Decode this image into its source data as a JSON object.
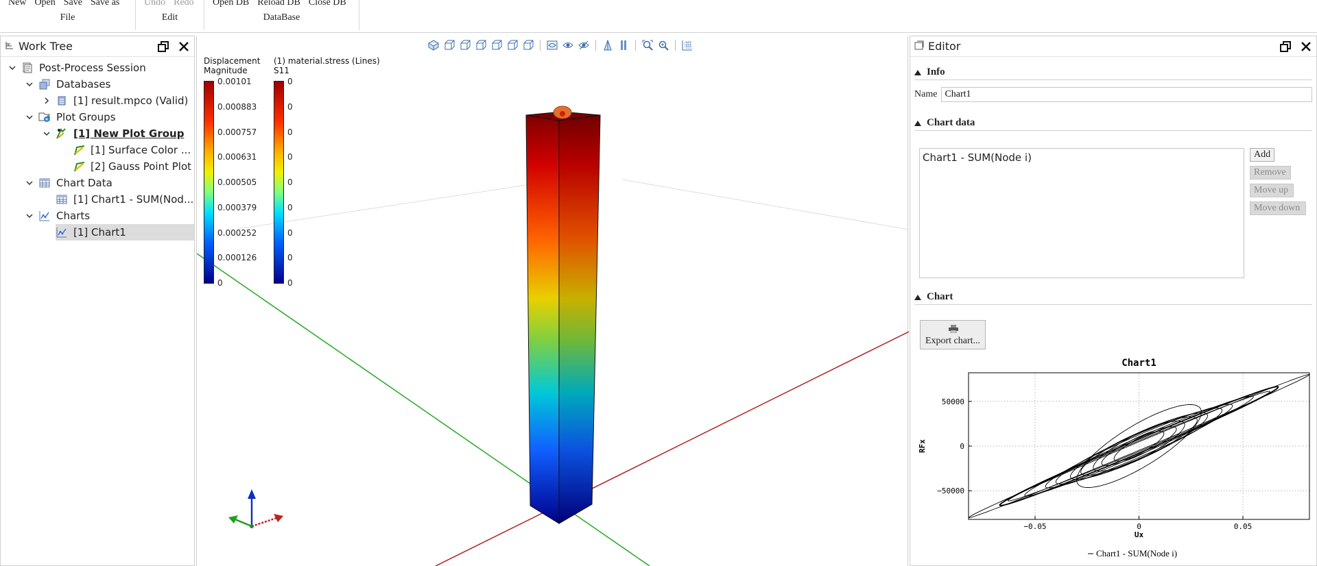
{
  "ribbon": {
    "groups": [
      {
        "title": "File",
        "buttons": [
          {
            "label": "New"
          },
          {
            "label": "Open"
          },
          {
            "label": "Save"
          },
          {
            "label": "Save as"
          }
        ]
      },
      {
        "title": "Edit",
        "buttons": [
          {
            "label": "Undo",
            "disabled": true
          },
          {
            "label": "Redo",
            "disabled": true
          }
        ]
      },
      {
        "title": "DataBase",
        "buttons": [
          {
            "label": "Open DB"
          },
          {
            "label": "Reload DB"
          },
          {
            "label": "Close DB"
          }
        ]
      }
    ]
  },
  "worktree": {
    "title": "Work Tree",
    "items": [
      {
        "label": "Post-Process Session",
        "level": 0,
        "icon": "session-icon",
        "expanded": true
      },
      {
        "label": "Databases",
        "level": 1,
        "icon": "database-icon",
        "expanded": true
      },
      {
        "label": "[1] result.mpco (Valid)",
        "level": 2,
        "icon": "file-icon",
        "expanded": false
      },
      {
        "label": "Plot Groups",
        "level": 1,
        "icon": "plot-groups-icon",
        "expanded": true
      },
      {
        "label": "[1] New Plot Group",
        "level": 2,
        "icon": "plot-group-icon",
        "expanded": true,
        "bold": true
      },
      {
        "label": "[1] Surface Color ...",
        "level": 3,
        "icon": "plot-icon"
      },
      {
        "label": "[2] Gauss Point Plot",
        "level": 3,
        "icon": "plot-icon"
      },
      {
        "label": "Chart Data",
        "level": 1,
        "icon": "table-icon",
        "expanded": true
      },
      {
        "label": "[1] Chart1 - SUM(Nod...",
        "level": 2,
        "icon": "table-icon"
      },
      {
        "label": "Charts",
        "level": 1,
        "icon": "chart-icon",
        "expanded": true
      },
      {
        "label": "[1] Chart1",
        "level": 2,
        "icon": "chart-icon",
        "selected": true
      }
    ]
  },
  "viewport": {
    "legend1": {
      "title1": "Displacement",
      "title2": "Magnitude",
      "ticks": [
        "0.00101",
        "0.000883",
        "0.000757",
        "0.000631",
        "0.000505",
        "0.000379",
        "0.000252",
        "0.000126",
        "0"
      ]
    },
    "legend2": {
      "title1": "(1) material.stress (Lines)",
      "title2": "S11",
      "ticks": [
        "0",
        "0",
        "0",
        "0",
        "0",
        "0",
        "0",
        "0",
        "0"
      ]
    },
    "colors": {
      "x_axis": "#b22222",
      "y_axis": "#22aa22",
      "z_axis": "#2222cc"
    }
  },
  "editor": {
    "title": "Editor",
    "info": {
      "header": "Info",
      "name_label": "Name",
      "name_value": "Chart1"
    },
    "chart_data_section": {
      "header": "Chart data",
      "items": [
        "Chart1 - SUM(Node i)"
      ],
      "buttons": [
        {
          "label": "Add",
          "disabled": false
        },
        {
          "label": "Remove",
          "disabled": true
        },
        {
          "label": "Move up",
          "disabled": true
        },
        {
          "label": "Move down",
          "disabled": true
        }
      ]
    },
    "chart_section": {
      "header": "Chart",
      "export_label": "Export chart..."
    }
  },
  "chart_data": {
    "type": "line",
    "title": "Chart1",
    "xlabel": "Ux",
    "ylabel": "RFx",
    "xlim": [
      -0.082,
      0.082
    ],
    "ylim": [
      -82000,
      82000
    ],
    "xticks": [
      -0.05,
      0,
      0.05
    ],
    "yticks": [
      -50000,
      0,
      50000
    ],
    "xtick_labels": [
      "−0.05",
      "0",
      "0.05"
    ],
    "ytick_labels": [
      "−50000",
      "0",
      "50000"
    ],
    "grid": true,
    "legend": "bottom",
    "series": [
      {
        "name": "Chart1 - SUM(Node i)",
        "color": "#000000"
      }
    ],
    "hysteresis_loops": [
      {
        "amp_x": 0.082,
        "amp_y": 80000,
        "width": 0.06
      },
      {
        "amp_x": 0.067,
        "amp_y": 66000,
        "width": 0.12
      },
      {
        "amp_x": 0.063,
        "amp_y": 61000,
        "width": 0.1
      },
      {
        "amp_x": 0.055,
        "amp_y": 55000,
        "width": 0.18
      },
      {
        "amp_x": 0.045,
        "amp_y": 45000,
        "width": 0.28
      },
      {
        "amp_x": 0.04,
        "amp_y": 40000,
        "width": 0.35
      },
      {
        "amp_x": 0.033,
        "amp_y": 34000,
        "width": 0.45
      },
      {
        "amp_x": 0.028,
        "amp_y": 29000,
        "width": 0.52
      },
      {
        "amp_x": 0.022,
        "amp_y": 24000,
        "width": 0.6
      },
      {
        "amp_x": 0.018,
        "amp_y": 19000,
        "width": 0.55
      },
      {
        "amp_x": 0.012,
        "amp_y": 14000,
        "width": 0.65
      },
      {
        "amp_x": 0.03,
        "amp_y": 38000,
        "width": 0.7
      }
    ]
  }
}
